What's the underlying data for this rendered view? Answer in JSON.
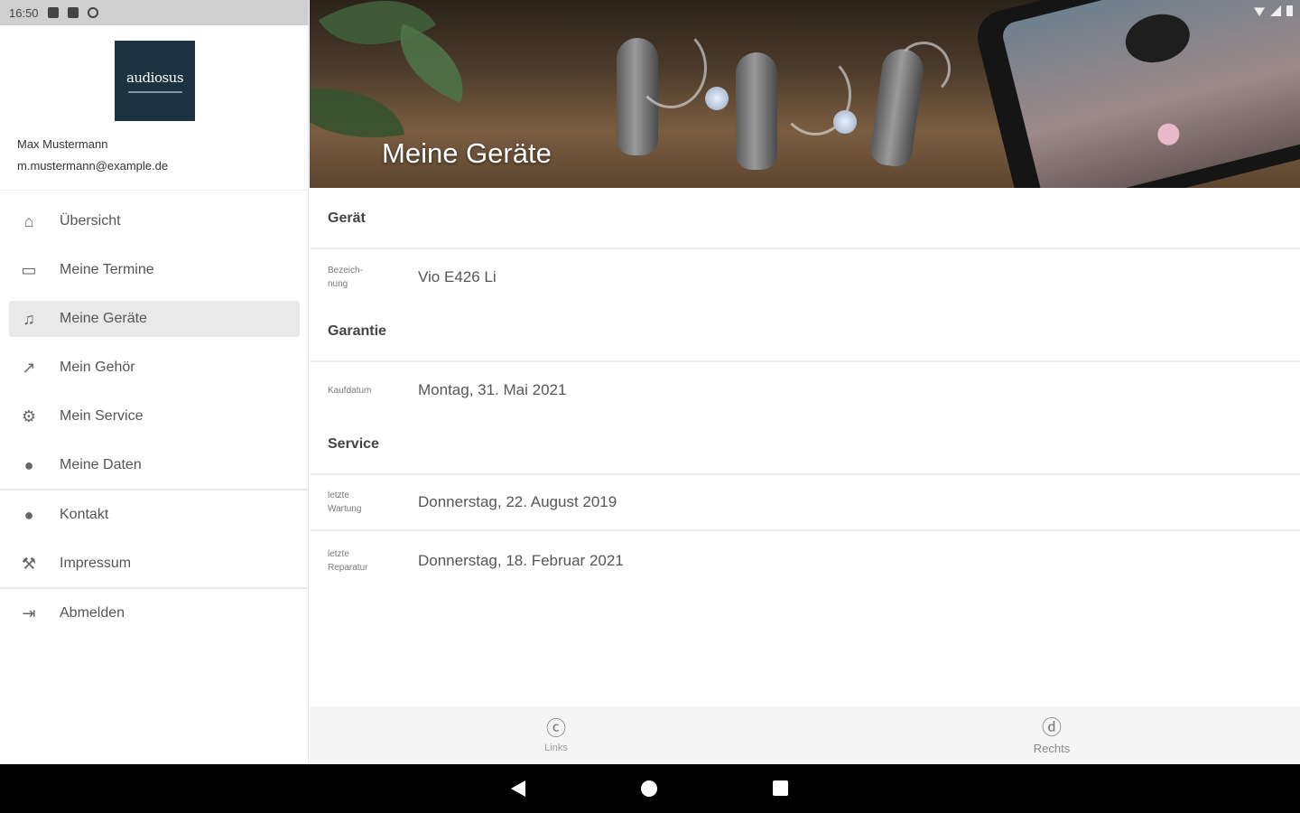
{
  "statusbar": {
    "time": "16:50"
  },
  "sidebar": {
    "logo_text": "audiosus",
    "user_name": "Max Mustermann",
    "user_email": "m.mustermann@example.de",
    "items": [
      {
        "label": "Übersicht",
        "icon": "home-icon",
        "glyph": "⌂"
      },
      {
        "label": "Meine Termine",
        "icon": "calendar-icon",
        "glyph": "▭"
      },
      {
        "label": "Meine Geräte",
        "icon": "hearing-aid-icon",
        "glyph": "♫",
        "active": true
      },
      {
        "label": "Mein Gehör",
        "icon": "chart-icon",
        "glyph": "↗"
      },
      {
        "label": "Mein Service",
        "icon": "gears-icon",
        "glyph": "⚙"
      },
      {
        "label": "Meine Daten",
        "icon": "user-icon",
        "glyph": "●"
      },
      {
        "label": "Kontakt",
        "icon": "chat-icon",
        "glyph": "●"
      },
      {
        "label": "Impressum",
        "icon": "hammer-icon",
        "glyph": "⚒"
      },
      {
        "label": "Abmelden",
        "icon": "logout-icon",
        "glyph": "⇥"
      }
    ]
  },
  "hero": {
    "title": "Meine Geräte"
  },
  "main": {
    "sections": [
      {
        "title": "Gerät",
        "rows": [
          {
            "label": "Bezeich-\nnung",
            "value": "Vio E426 Li"
          }
        ]
      },
      {
        "title": "Garantie",
        "rows": [
          {
            "label": "Kaufdatum",
            "value": "Montag, 31. Mai 2021"
          }
        ]
      },
      {
        "title": "Service",
        "rows": [
          {
            "label": "letzte\nWartung",
            "value": "Donnerstag, 22. August 2019"
          },
          {
            "label": "letzte\nReparatur",
            "value": "Donnerstag, 18. Februar 2021"
          }
        ]
      }
    ]
  },
  "bottom_tabs": [
    {
      "label": "Links",
      "icon": "ear-left-icon",
      "glyph": "ⓒ"
    },
    {
      "label": "Rechts",
      "icon": "ear-right-icon",
      "glyph": "ⓓ"
    }
  ]
}
